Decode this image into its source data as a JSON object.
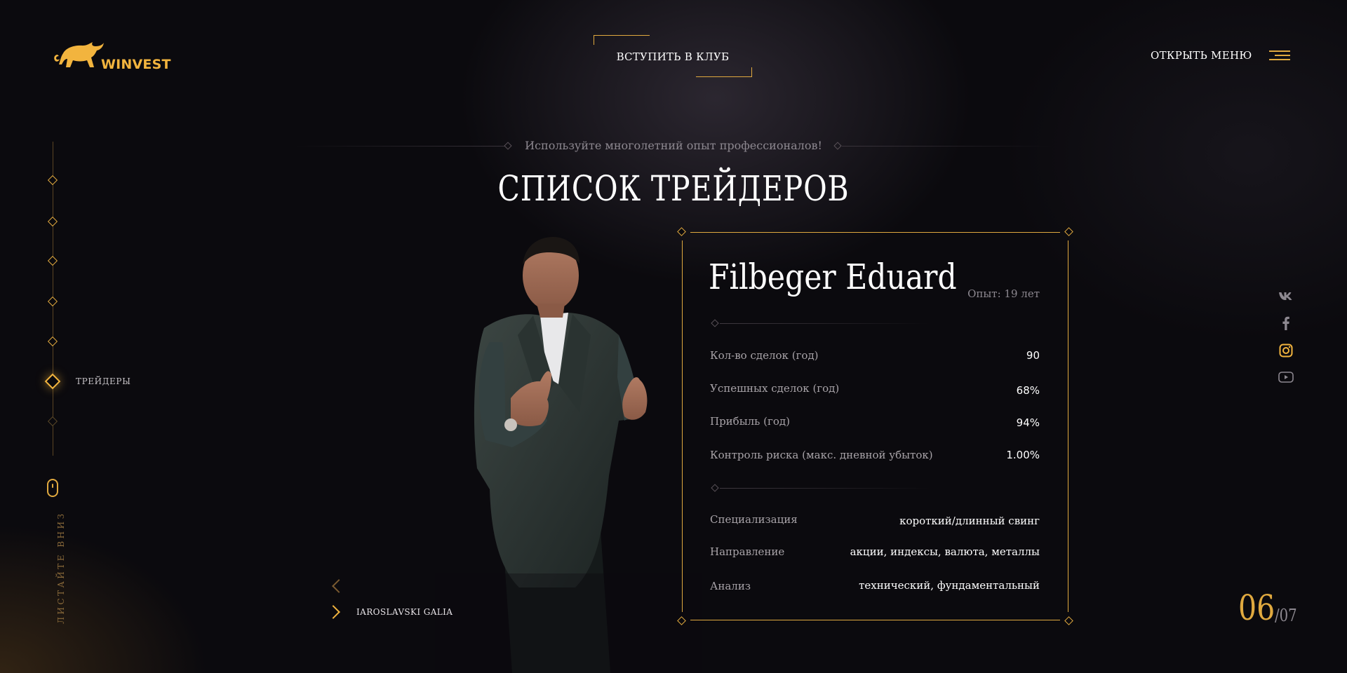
{
  "brand": {
    "name": "WINVEST",
    "accent_color": "#e0a93f"
  },
  "header": {
    "join_label": "ВСТУПИТЬ В КЛУБ",
    "menu_label": "ОТКРЫТЬ МЕНЮ"
  },
  "side_nav": {
    "active_label": "ТРЕЙДЕРЫ",
    "scroll_hint": "ЛИСТАЙТЕ ВНИЗ"
  },
  "section": {
    "subtitle": "Используйте многолетний опыт профессионалов!",
    "title": "СПИСОК ТРЕЙДЕРОВ"
  },
  "trader": {
    "name": "Filbeger Eduard",
    "experience": "Опыт: 19 лет",
    "stats": [
      {
        "label": "Кол-во сделок (год)",
        "value": "90"
      },
      {
        "label": "Успешных сделок (год)",
        "value": "68%"
      },
      {
        "label": "Прибыль (год)",
        "value": "94%"
      },
      {
        "label": "Контроль риска (макс. дневной убыток)",
        "value": "1.00%"
      }
    ],
    "details": [
      {
        "label": "Специализация",
        "value": "короткий/длинный свинг"
      },
      {
        "label": "Направление",
        "value": "акции, индексы, валюта, металлы"
      },
      {
        "label": "Анализ",
        "value": "технический, фундаментальный"
      }
    ]
  },
  "carousel": {
    "next_name": "IAROSLAVSKI GALIA"
  },
  "socials": [
    "vk-icon",
    "facebook-icon",
    "instagram-icon",
    "youtube-icon"
  ],
  "counter": {
    "current": "06",
    "total": "/07"
  }
}
